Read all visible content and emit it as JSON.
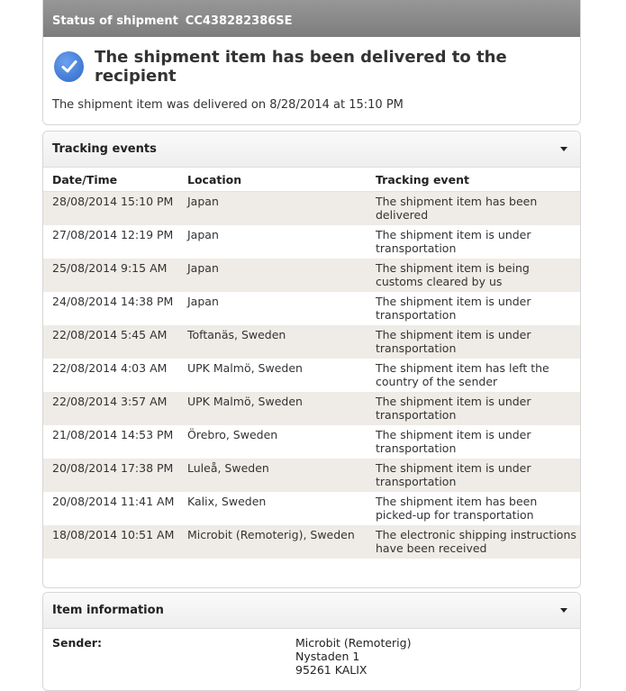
{
  "status": {
    "header_label": "Status of shipment",
    "shipment_id": "CC438282386SE",
    "title": "The shipment item has been delivered to the recipient",
    "subtitle": "The shipment item was delivered on 8/28/2014 at 15:10 PM"
  },
  "tracking": {
    "section_title": "Tracking events",
    "columns": [
      "Date/Time",
      "Location",
      "Tracking event"
    ],
    "rows": [
      {
        "datetime": "28/08/2014 15:10 PM",
        "location": "Japan",
        "event": "The shipment item has been delivered"
      },
      {
        "datetime": "27/08/2014 12:19 PM",
        "location": "Japan",
        "event": "The shipment item is under transportation"
      },
      {
        "datetime": "25/08/2014 9:15 AM",
        "location": "Japan",
        "event": "The shipment item is being customs cleared by us"
      },
      {
        "datetime": "24/08/2014 14:38 PM",
        "location": "Japan",
        "event": "The shipment item is under transportation"
      },
      {
        "datetime": "22/08/2014 5:45 AM",
        "location": "Toftanäs, Sweden",
        "event": "The shipment item is under transportation"
      },
      {
        "datetime": "22/08/2014 4:03 AM",
        "location": "UPK Malmö, Sweden",
        "event": "The shipment item has left the country of the sender"
      },
      {
        "datetime": "22/08/2014 3:57 AM",
        "location": "UPK Malmö, Sweden",
        "event": "The shipment item is under transportation"
      },
      {
        "datetime": "21/08/2014 14:53 PM",
        "location": "Örebro, Sweden",
        "event": "The shipment item is under transportation"
      },
      {
        "datetime": "20/08/2014 17:38 PM",
        "location": "Luleå, Sweden",
        "event": "The shipment item is under transportation"
      },
      {
        "datetime": "20/08/2014 11:41 AM",
        "location": "Kalix, Sweden",
        "event": "The shipment item has been picked-up for transportation"
      },
      {
        "datetime": "18/08/2014 10:51 AM",
        "location": "Microbit (Remoterig), Sweden",
        "event": "The electronic shipping instructions have been received"
      }
    ]
  },
  "item_info": {
    "section_title": "Item information",
    "sender_label": "Sender:",
    "sender_lines": [
      "Microbit (Remoterig)",
      "Nystaden 1",
      "95261 KALIX"
    ]
  },
  "colors": {
    "header_gray": "#8a8a8a",
    "row_alt": "#efebe6",
    "check_blue": "#3a74d4"
  }
}
